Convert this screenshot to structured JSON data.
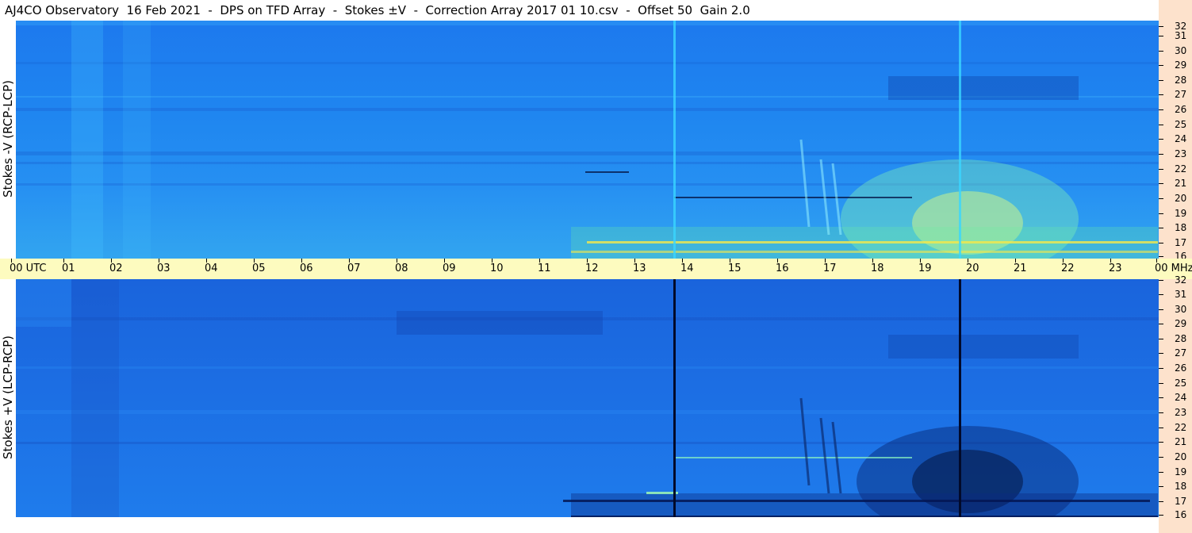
{
  "title": "AJ4CO Observatory  16 Feb 2021  -  DPS on TFD Array  -  Stokes ±V  -  Correction Array 2017 01 10.csv  -  Offset 50  Gain 2.0",
  "panels": {
    "top": {
      "ylabel": "Stokes -V (RCP-LCP)"
    },
    "bottom": {
      "ylabel": "Stokes +V (LCP-RCP)"
    }
  },
  "freq_ticks": [
    "32",
    "31",
    "30",
    "29",
    "28",
    "27",
    "26",
    "25",
    "24",
    "23",
    "22",
    "21",
    "20",
    "19",
    "18",
    "17",
    "16"
  ],
  "time_ticks": [
    "00 UTC",
    "01",
    "02",
    "03",
    "04",
    "05",
    "06",
    "07",
    "08",
    "09",
    "10",
    "11",
    "12",
    "13",
    "14",
    "15",
    "16",
    "17",
    "18",
    "19",
    "20",
    "21",
    "22",
    "23",
    "00 MHz"
  ],
  "colors": {
    "top_background": "#1f86f0",
    "bottom_background": "#1c6fe4",
    "time_axis_background": "#fdfbbf",
    "right_strip": "#fde2cc",
    "hot_band": "#7cff9a",
    "dark_band": "#061a4a"
  }
}
